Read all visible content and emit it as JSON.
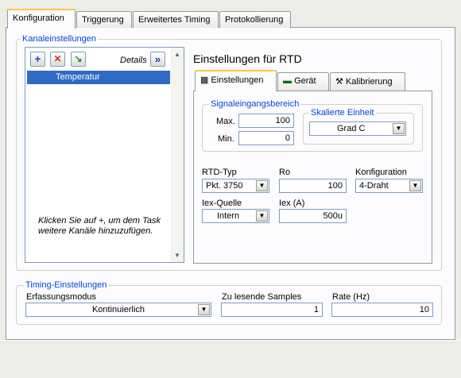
{
  "tabs": [
    "Konfiguration",
    "Triggerung",
    "Erweitertes Timing",
    "Protokollierung"
  ],
  "channels": {
    "legend": "Kanaleinstellungen",
    "details_label": "Details",
    "selected_channel": "Temperatur",
    "hint": "Klicken Sie auf +, um dem Task weitere Kanäle hinzuzufügen.",
    "buttons": {
      "add": "+",
      "remove": "✕",
      "move": "↘",
      "details": "»"
    }
  },
  "settings": {
    "title": "Einstellungen für RTD",
    "tabs": [
      "Einstellungen",
      "Gerät",
      "Kalibrierung"
    ],
    "signal_range": {
      "legend": "Signaleingangsbereich",
      "max_label": "Max.",
      "max_value": "100",
      "min_label": "Min.",
      "min_value": "0"
    },
    "scaled_unit": {
      "legend": "Skalierte Einheit",
      "value": "Grad C"
    },
    "rtd_type": {
      "label": "RTD-Typ",
      "value": "Pkt. 3750"
    },
    "ro": {
      "label": "Ro",
      "value": "100"
    },
    "configuration": {
      "label": "Konfiguration",
      "value": "4-Draht"
    },
    "iex_source": {
      "label": "Iex-Quelle",
      "value": "Intern"
    },
    "iex": {
      "label": "Iex (A)",
      "value": "500u"
    }
  },
  "timing": {
    "legend": "Timing-Einstellungen",
    "mode_label": "Erfassungsmodus",
    "mode_value": "Kontinuierlich",
    "samples_label": "Zu lesende Samples",
    "samples_value": "1",
    "rate_label": "Rate (Hz)",
    "rate_value": "10"
  }
}
